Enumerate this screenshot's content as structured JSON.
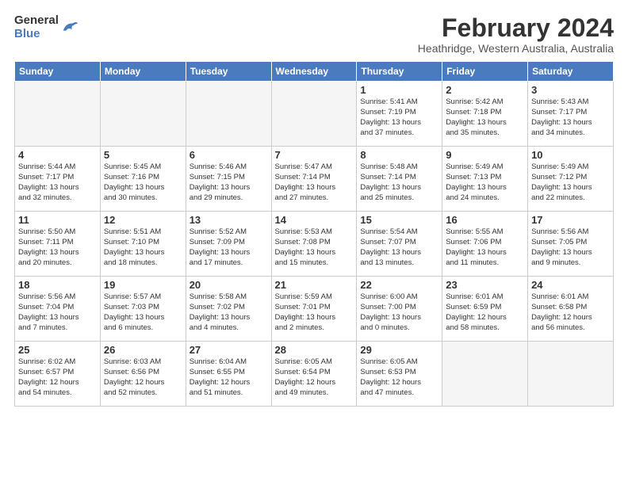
{
  "logo": {
    "general": "General",
    "blue": "Blue"
  },
  "title": "February 2024",
  "subtitle": "Heathridge, Western Australia, Australia",
  "days_of_week": [
    "Sunday",
    "Monday",
    "Tuesday",
    "Wednesday",
    "Thursday",
    "Friday",
    "Saturday"
  ],
  "weeks": [
    [
      {
        "day": "",
        "info": ""
      },
      {
        "day": "",
        "info": ""
      },
      {
        "day": "",
        "info": ""
      },
      {
        "day": "",
        "info": ""
      },
      {
        "day": "1",
        "info": "Sunrise: 5:41 AM\nSunset: 7:19 PM\nDaylight: 13 hours\nand 37 minutes."
      },
      {
        "day": "2",
        "info": "Sunrise: 5:42 AM\nSunset: 7:18 PM\nDaylight: 13 hours\nand 35 minutes."
      },
      {
        "day": "3",
        "info": "Sunrise: 5:43 AM\nSunset: 7:17 PM\nDaylight: 13 hours\nand 34 minutes."
      }
    ],
    [
      {
        "day": "4",
        "info": "Sunrise: 5:44 AM\nSunset: 7:17 PM\nDaylight: 13 hours\nand 32 minutes."
      },
      {
        "day": "5",
        "info": "Sunrise: 5:45 AM\nSunset: 7:16 PM\nDaylight: 13 hours\nand 30 minutes."
      },
      {
        "day": "6",
        "info": "Sunrise: 5:46 AM\nSunset: 7:15 PM\nDaylight: 13 hours\nand 29 minutes."
      },
      {
        "day": "7",
        "info": "Sunrise: 5:47 AM\nSunset: 7:14 PM\nDaylight: 13 hours\nand 27 minutes."
      },
      {
        "day": "8",
        "info": "Sunrise: 5:48 AM\nSunset: 7:14 PM\nDaylight: 13 hours\nand 25 minutes."
      },
      {
        "day": "9",
        "info": "Sunrise: 5:49 AM\nSunset: 7:13 PM\nDaylight: 13 hours\nand 24 minutes."
      },
      {
        "day": "10",
        "info": "Sunrise: 5:49 AM\nSunset: 7:12 PM\nDaylight: 13 hours\nand 22 minutes."
      }
    ],
    [
      {
        "day": "11",
        "info": "Sunrise: 5:50 AM\nSunset: 7:11 PM\nDaylight: 13 hours\nand 20 minutes."
      },
      {
        "day": "12",
        "info": "Sunrise: 5:51 AM\nSunset: 7:10 PM\nDaylight: 13 hours\nand 18 minutes."
      },
      {
        "day": "13",
        "info": "Sunrise: 5:52 AM\nSunset: 7:09 PM\nDaylight: 13 hours\nand 17 minutes."
      },
      {
        "day": "14",
        "info": "Sunrise: 5:53 AM\nSunset: 7:08 PM\nDaylight: 13 hours\nand 15 minutes."
      },
      {
        "day": "15",
        "info": "Sunrise: 5:54 AM\nSunset: 7:07 PM\nDaylight: 13 hours\nand 13 minutes."
      },
      {
        "day": "16",
        "info": "Sunrise: 5:55 AM\nSunset: 7:06 PM\nDaylight: 13 hours\nand 11 minutes."
      },
      {
        "day": "17",
        "info": "Sunrise: 5:56 AM\nSunset: 7:05 PM\nDaylight: 13 hours\nand 9 minutes."
      }
    ],
    [
      {
        "day": "18",
        "info": "Sunrise: 5:56 AM\nSunset: 7:04 PM\nDaylight: 13 hours\nand 7 minutes."
      },
      {
        "day": "19",
        "info": "Sunrise: 5:57 AM\nSunset: 7:03 PM\nDaylight: 13 hours\nand 6 minutes."
      },
      {
        "day": "20",
        "info": "Sunrise: 5:58 AM\nSunset: 7:02 PM\nDaylight: 13 hours\nand 4 minutes."
      },
      {
        "day": "21",
        "info": "Sunrise: 5:59 AM\nSunset: 7:01 PM\nDaylight: 13 hours\nand 2 minutes."
      },
      {
        "day": "22",
        "info": "Sunrise: 6:00 AM\nSunset: 7:00 PM\nDaylight: 13 hours\nand 0 minutes."
      },
      {
        "day": "23",
        "info": "Sunrise: 6:01 AM\nSunset: 6:59 PM\nDaylight: 12 hours\nand 58 minutes."
      },
      {
        "day": "24",
        "info": "Sunrise: 6:01 AM\nSunset: 6:58 PM\nDaylight: 12 hours\nand 56 minutes."
      }
    ],
    [
      {
        "day": "25",
        "info": "Sunrise: 6:02 AM\nSunset: 6:57 PM\nDaylight: 12 hours\nand 54 minutes."
      },
      {
        "day": "26",
        "info": "Sunrise: 6:03 AM\nSunset: 6:56 PM\nDaylight: 12 hours\nand 52 minutes."
      },
      {
        "day": "27",
        "info": "Sunrise: 6:04 AM\nSunset: 6:55 PM\nDaylight: 12 hours\nand 51 minutes."
      },
      {
        "day": "28",
        "info": "Sunrise: 6:05 AM\nSunset: 6:54 PM\nDaylight: 12 hours\nand 49 minutes."
      },
      {
        "day": "29",
        "info": "Sunrise: 6:05 AM\nSunset: 6:53 PM\nDaylight: 12 hours\nand 47 minutes."
      },
      {
        "day": "",
        "info": ""
      },
      {
        "day": "",
        "info": ""
      }
    ]
  ]
}
